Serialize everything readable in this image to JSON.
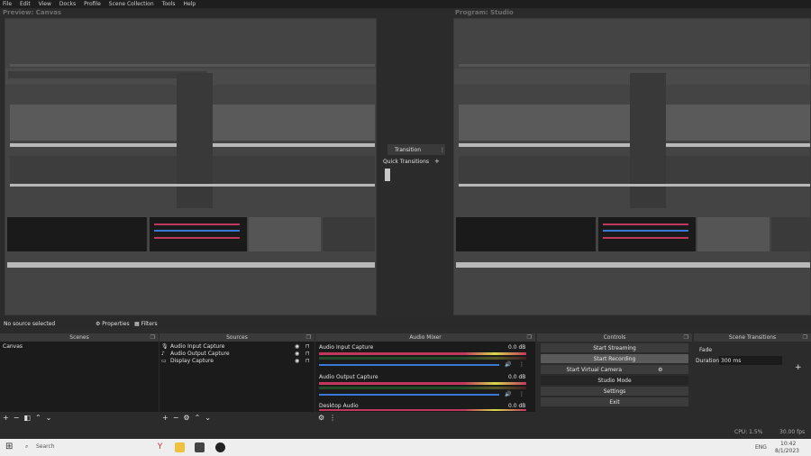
{
  "menu": [
    "File",
    "Edit",
    "View",
    "Docks",
    "Profile",
    "Scene Collection",
    "Tools",
    "Help"
  ],
  "preview_title": "Preview: Canvas",
  "program_title": "Program: Studio",
  "transitions": {
    "label": "Transition",
    "quick_label": "Quick Transitions",
    "menu_icon": "kebab-icon",
    "add_icon": "plus-icon"
  },
  "context_bar": {
    "no_source": "No source selected",
    "properties": "Properties",
    "filters": "Filters"
  },
  "docks": {
    "scenes": {
      "title": "Scenes",
      "items": [
        "Canvas"
      ]
    },
    "sources": {
      "title": "Sources",
      "items": [
        {
          "name": "Audio Input Capture",
          "icon": "mic-icon"
        },
        {
          "name": "Audio Output Capture",
          "icon": "speaker-icon"
        },
        {
          "name": "Display Capture",
          "icon": "monitor-icon"
        }
      ]
    },
    "mixer": {
      "title": "Audio Mixer",
      "channels": [
        {
          "name": "Audio Input Capture",
          "db": "0.0 dB"
        },
        {
          "name": "Audio Output Capture",
          "db": "0.0 dB"
        }
      ],
      "third": "Desktop Audio",
      "third_db": "0.0 dB"
    },
    "controls": {
      "title": "Controls",
      "buttons": [
        "Start Streaming",
        "Start Recording",
        "Start Virtual Camera",
        "Studio Mode",
        "Settings",
        "Exit"
      ]
    },
    "transitions": {
      "title": "Scene Transitions",
      "fade": "Fade",
      "duration_label": "Duration",
      "duration_value": "300 ms"
    }
  },
  "status": {
    "cpu": "CPU: 1.5%",
    "fps": "30.00 fps"
  },
  "taskbar": {
    "search_placeholder": "Search",
    "time": "10:42",
    "date": "8/1/2023",
    "lang": "ENG"
  },
  "colors": {
    "meter_red": "#c0385e",
    "meter_green": "#2f8f3a",
    "slider": "#3a78d6",
    "taskbar": "#eeeeee"
  }
}
